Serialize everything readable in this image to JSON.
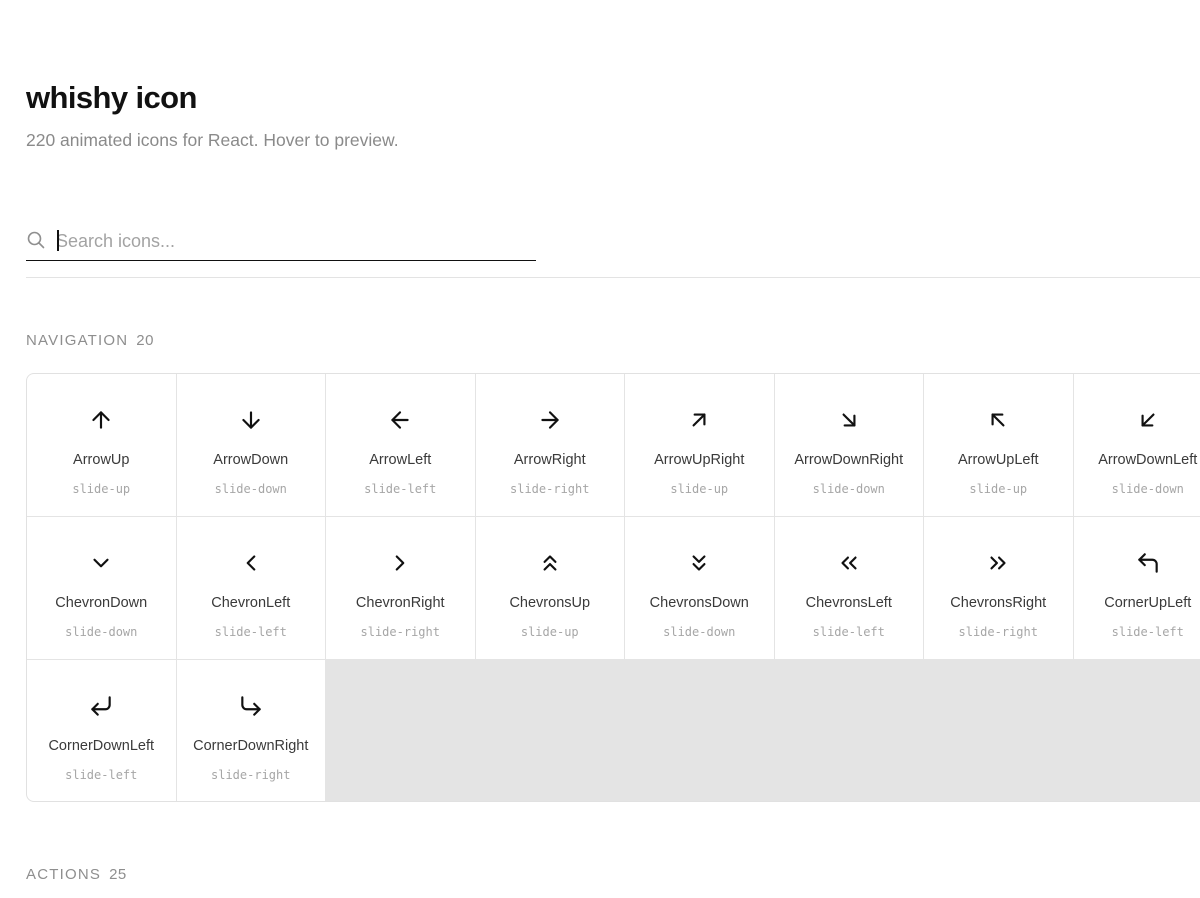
{
  "header": {
    "title": "whishy icon",
    "subtitle": "220 animated icons for React. Hover to preview."
  },
  "search": {
    "placeholder": "Search icons...",
    "value": ""
  },
  "sections": [
    {
      "label": "NAVIGATION",
      "count": "20",
      "icons": [
        {
          "name": "ArrowUp",
          "animation": "slide-up",
          "icon": "arrow-up-icon"
        },
        {
          "name": "ArrowDown",
          "animation": "slide-down",
          "icon": "arrow-down-icon"
        },
        {
          "name": "ArrowLeft",
          "animation": "slide-left",
          "icon": "arrow-left-icon"
        },
        {
          "name": "ArrowRight",
          "animation": "slide-right",
          "icon": "arrow-right-icon"
        },
        {
          "name": "ArrowUpRight",
          "animation": "slide-up",
          "icon": "arrow-up-right-icon"
        },
        {
          "name": "ArrowDownRight",
          "animation": "slide-down",
          "icon": "arrow-down-right-icon"
        },
        {
          "name": "ArrowUpLeft",
          "animation": "slide-up",
          "icon": "arrow-up-left-icon"
        },
        {
          "name": "ArrowDownLeft",
          "animation": "slide-down",
          "icon": "arrow-down-left-icon"
        },
        {
          "name": "ChevronDown",
          "animation": "slide-down",
          "icon": "chevron-down-icon"
        },
        {
          "name": "ChevronLeft",
          "animation": "slide-left",
          "icon": "chevron-left-icon"
        },
        {
          "name": "ChevronRight",
          "animation": "slide-right",
          "icon": "chevron-right-icon"
        },
        {
          "name": "ChevronsUp",
          "animation": "slide-up",
          "icon": "chevrons-up-icon"
        },
        {
          "name": "ChevronsDown",
          "animation": "slide-down",
          "icon": "chevrons-down-icon"
        },
        {
          "name": "ChevronsLeft",
          "animation": "slide-left",
          "icon": "chevrons-left-icon"
        },
        {
          "name": "ChevronsRight",
          "animation": "slide-right",
          "icon": "chevrons-right-icon"
        },
        {
          "name": "CornerUpLeft",
          "animation": "slide-left",
          "icon": "corner-up-left-icon"
        },
        {
          "name": "CornerDownLeft",
          "animation": "slide-left",
          "icon": "corner-down-left-icon"
        },
        {
          "name": "CornerDownRight",
          "animation": "slide-right",
          "icon": "corner-down-right-icon"
        }
      ]
    },
    {
      "label": "ACTIONS",
      "count": "25"
    }
  ],
  "colors": {
    "text": "#111111",
    "muted": "#8a8a8a",
    "border": "#e1e1e1",
    "grid_gap": "#e4e4e4"
  }
}
